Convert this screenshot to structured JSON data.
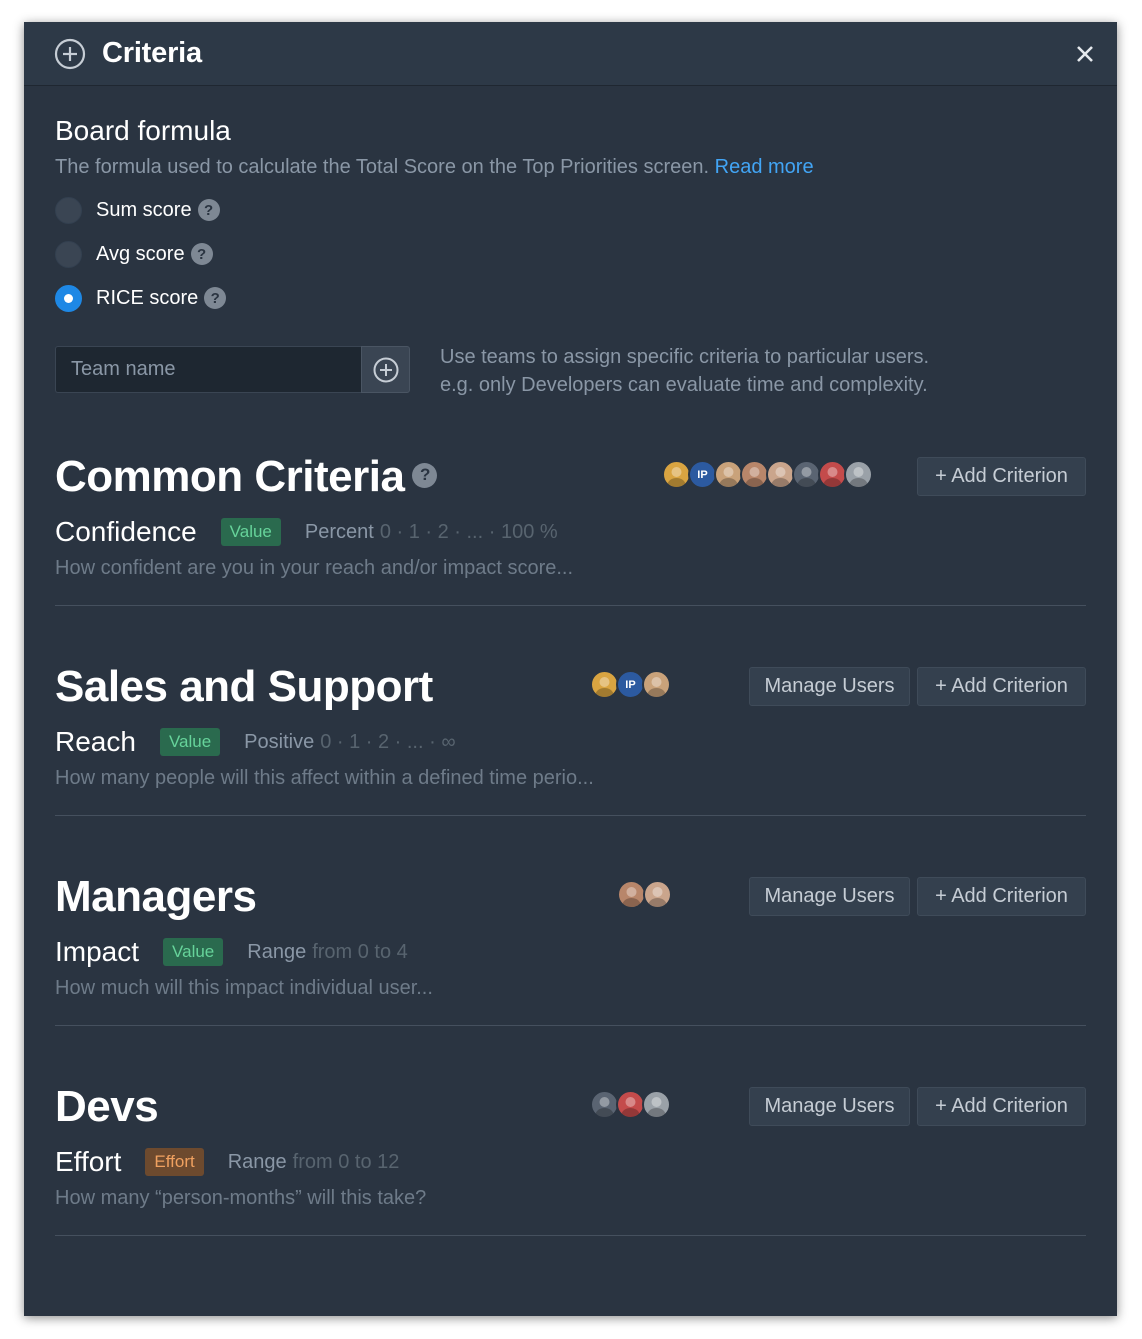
{
  "modal": {
    "title": "Criteria",
    "header_icon": "add-circle-icon",
    "close_icon": "close-icon"
  },
  "board_formula": {
    "heading": "Board formula",
    "description": "The formula used to calculate the Total Score on the Top Priorities screen.",
    "read_more": "Read more",
    "options": [
      {
        "label": "Sum score",
        "checked": false
      },
      {
        "label": "Avg score",
        "checked": false
      },
      {
        "label": "RICE score",
        "checked": true
      }
    ]
  },
  "team": {
    "placeholder": "Team name",
    "hint_line1": "Use teams to assign specific criteria to particular users.",
    "hint_line2": "e.g. only Developers can evaluate time and complexity."
  },
  "buttons": {
    "add_criterion": "+ Add Criterion",
    "manage_users": "Manage Users"
  },
  "groups": [
    {
      "title": "Common Criteria",
      "criterion": {
        "name": "Confidence",
        "badge": "Value",
        "type": "Percent",
        "range": "0 · 1 · 2 · ... · 100 %",
        "description": "How confident are you in your reach and/or impact score..."
      },
      "avatars": [
        "#d9a441",
        "#2c5aa0",
        "#c9a27a",
        "#b8866a",
        "#caa58c",
        "#5a6472",
        "#c44b4b",
        "#9aa1a8"
      ],
      "avatar_initials": [
        "",
        "IP",
        "",
        "",
        "",
        "",
        "",
        ""
      ]
    },
    {
      "title": "Sales and Support",
      "criterion": {
        "name": "Reach",
        "badge": "Value",
        "type": "Positive",
        "range": "0 · 1 · 2 · ... · ∞",
        "description": "How many people will this affect within a defined time perio..."
      },
      "avatars": [
        "#d9a441",
        "#2c5aa0",
        "#c9a27a"
      ],
      "avatar_initials": [
        "",
        "IP",
        ""
      ]
    },
    {
      "title": "Managers",
      "criterion": {
        "name": "Impact",
        "badge": "Value",
        "type": "Range",
        "range": "from 0 to 4",
        "description": "How much will this impact individual user..."
      },
      "avatars": [
        "#b8866a",
        "#caa58c"
      ],
      "avatar_initials": [
        "",
        ""
      ]
    },
    {
      "title": "Devs",
      "criterion": {
        "name": "Effort",
        "badge": "Effort",
        "type": "Range",
        "range": "from 0 to 12",
        "description": "How many “person-months” will this take?"
      },
      "avatars": [
        "#5a6472",
        "#c44b4b",
        "#9aa1a8"
      ],
      "avatar_initials": [
        "",
        "",
        ""
      ]
    }
  ]
}
